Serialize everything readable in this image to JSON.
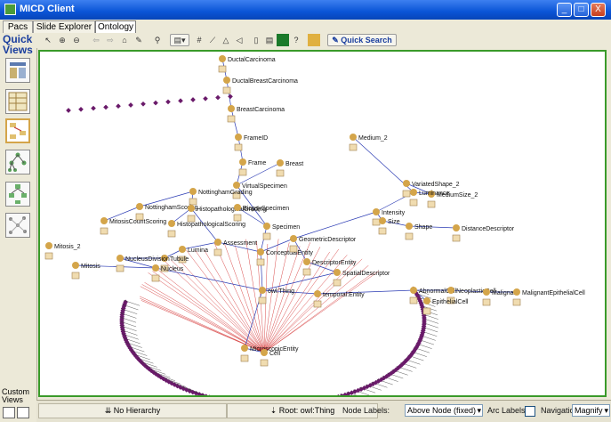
{
  "window": {
    "title": "MICD Client",
    "minimize": "_",
    "maximize": "□",
    "close": "X"
  },
  "tabs": [
    {
      "label": "Pacs"
    },
    {
      "label": "Slide Explorer"
    },
    {
      "label": "Ontology"
    }
  ],
  "quick_views": {
    "label_line1": "Quick",
    "label_line2": "Views"
  },
  "custom_views": {
    "label_line1": "Custom",
    "label_line2": "Views"
  },
  "toolbar": {
    "quick_search_label": "Quick Search"
  },
  "graph": {
    "nodes": [
      {
        "label": "DuctalCarcinoma"
      },
      {
        "label": "DuctalBreastCarcinoma"
      },
      {
        "label": "BreastCarcinoma"
      },
      {
        "label": "FrameID"
      },
      {
        "label": "Frame"
      },
      {
        "label": "Breast"
      },
      {
        "label": "VirtualSpecimen"
      },
      {
        "label": "NottinghamGrading"
      },
      {
        "label": "NottinghamScoring"
      },
      {
        "label": "MitosisCountScoring"
      },
      {
        "label": "HistopathologicalGrading"
      },
      {
        "label": "HistopathologicalScoring"
      },
      {
        "label": "BiopsySpecimen"
      },
      {
        "label": "Specimen"
      },
      {
        "label": "Assessment"
      },
      {
        "label": "Lumina"
      },
      {
        "label": "Tubule"
      },
      {
        "label": "Mitosis"
      },
      {
        "label": "Mitosis_2"
      },
      {
        "label": "NucleusDivision"
      },
      {
        "label": "Nucleus"
      },
      {
        "label": "ConceptualEntity"
      },
      {
        "label": "GeometricDescriptor"
      },
      {
        "label": "DescriptorEntity"
      },
      {
        "label": "SpatialDescriptor"
      },
      {
        "label": "owl:Thing"
      },
      {
        "label": "temporal:Entity"
      },
      {
        "label": "MicroscopicEntity"
      },
      {
        "label": "Cell"
      },
      {
        "label": "AbnormalCell"
      },
      {
        "label": "NeoplasticCell"
      },
      {
        "label": "Malignant"
      },
      {
        "label": "MalignantEpithelialCell"
      },
      {
        "label": "EpithelialCell"
      },
      {
        "label": "Intensity"
      },
      {
        "label": "Size"
      },
      {
        "label": "MediumSize_2"
      },
      {
        "label": "VariatedShape_2"
      },
      {
        "label": "Medium_2"
      },
      {
        "label": "Shape"
      },
      {
        "label": "DistanceDescriptor"
      },
      {
        "label": "Luminance"
      }
    ]
  },
  "statusbar": {
    "hierarchy_label": "No Hierarchy",
    "root_label": "Root: owl:Thing",
    "node_labels_label": "Node Labels:",
    "node_labels_value": "Above Node (fixed)",
    "arc_labels_label": "Arc Labels:",
    "navigation_label": "Navigation:",
    "navigation_value": "Magnify"
  },
  "colors": {
    "accent_green": "#3a9a2a",
    "titlebar_blue": "#0a54d6",
    "node_gold": "#d4a54a",
    "node_purple": "#6a1a6a",
    "edge_blue": "#2c3cb4",
    "edge_red": "#d02020"
  }
}
